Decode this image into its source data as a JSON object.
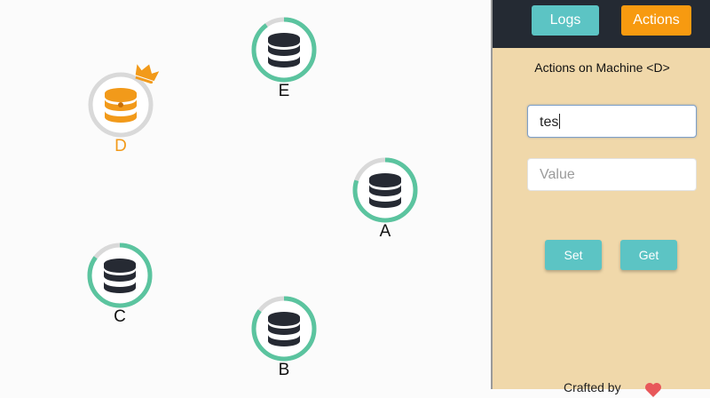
{
  "colors": {
    "ring_progress": "#5bc49f",
    "ring_track": "#d9d9d9",
    "leader": "#f29a1a",
    "database": "#262a33",
    "panel_bg": "#f0d8aa",
    "topbar_bg": "#242a33",
    "button_teal": "#5cc4c4",
    "button_orange": "#f79a10"
  },
  "nodes": [
    {
      "id": "E",
      "label": "E",
      "icon": "database-icon",
      "progress": 0.9,
      "leader": false
    },
    {
      "id": "D",
      "label": "D",
      "icon": "database-icon",
      "progress": 0.0,
      "leader": true
    },
    {
      "id": "A",
      "label": "A",
      "icon": "database-icon",
      "progress": 0.8,
      "leader": false
    },
    {
      "id": "C",
      "label": "C",
      "icon": "database-icon",
      "progress": 0.85,
      "leader": false
    },
    {
      "id": "B",
      "label": "B",
      "icon": "database-icon",
      "progress": 0.85,
      "leader": false
    }
  ],
  "panel": {
    "tabs": {
      "logs": "Logs",
      "actions": "Actions"
    },
    "title": "Actions on Machine <D>",
    "key_input": {
      "value": "tes",
      "placeholder": ""
    },
    "value_input": {
      "value": "",
      "placeholder": "Value"
    },
    "buttons": {
      "set": "Set",
      "get": "Get"
    },
    "footer_text": "Crafted by",
    "footer_icon": "heart-icon"
  }
}
